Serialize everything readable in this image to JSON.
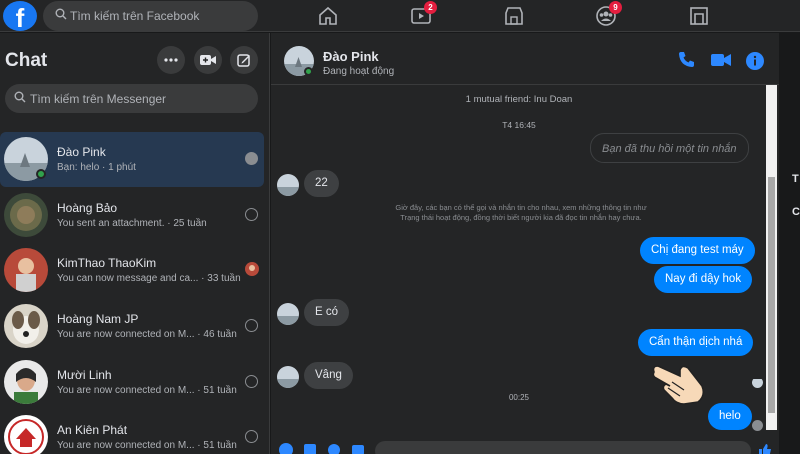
{
  "topbar": {
    "logo": "f",
    "search_placeholder": "Tìm kiếm trên Facebook",
    "nav": [
      {
        "icon": "home-icon",
        "badge": ""
      },
      {
        "icon": "watch-icon",
        "badge": "2"
      },
      {
        "icon": "marketplace-icon",
        "badge": ""
      },
      {
        "icon": "groups-icon",
        "badge": "9"
      },
      {
        "icon": "gaming-icon",
        "badge": ""
      }
    ]
  },
  "sidebar": {
    "title": "Chat",
    "search_placeholder": "Tìm kiếm trên Messenger",
    "conversations": [
      {
        "name": "Đào Pink",
        "preview": "Bạn: helo · 1 phút",
        "active": true,
        "online": true
      },
      {
        "name": "Hoàng Bảo",
        "preview": "You sent an attachment. · 25 tuần"
      },
      {
        "name": "KimThao ThaoKim",
        "preview": "You can now message and ca... · 33 tuần"
      },
      {
        "name": "Hoàng Nam JP",
        "preview": "You are now connected on M... · 46 tuần"
      },
      {
        "name": "Mười Linh",
        "preview": "You are now connected on M... · 51 tuần"
      },
      {
        "name": "An Kiên Phát",
        "preview": "You are now connected on M... · 51 tuần"
      }
    ]
  },
  "conversation": {
    "name": "Đào Pink",
    "status": "Đang hoạt động",
    "mutual": "1 mutual friend: Inu Doan",
    "time1": "T4 16:45",
    "recalled": "Bạn đã thu hồi một tin nhắn",
    "msg_22": "22",
    "notice": "Giờ đây, các bạn có thể gọi và nhắn tin cho nhau, xem những thông tin như Trạng thái hoạt động, đồng thời biết người kia đã đọc tin nhắn hay chưa.",
    "out1": "Chị đang test máy",
    "out2": "Nay đi dậy hok",
    "in_eco": "E có",
    "out3": "Cẩn thận dịch nhá",
    "in_vang": "Vâng",
    "time2": "00:25",
    "out4": "helo"
  },
  "rightstrip": {
    "a": "T",
    "b": "C"
  },
  "colors": {
    "accent": "#0084ff",
    "badge": "#e41e3f",
    "online": "#31a24c"
  }
}
